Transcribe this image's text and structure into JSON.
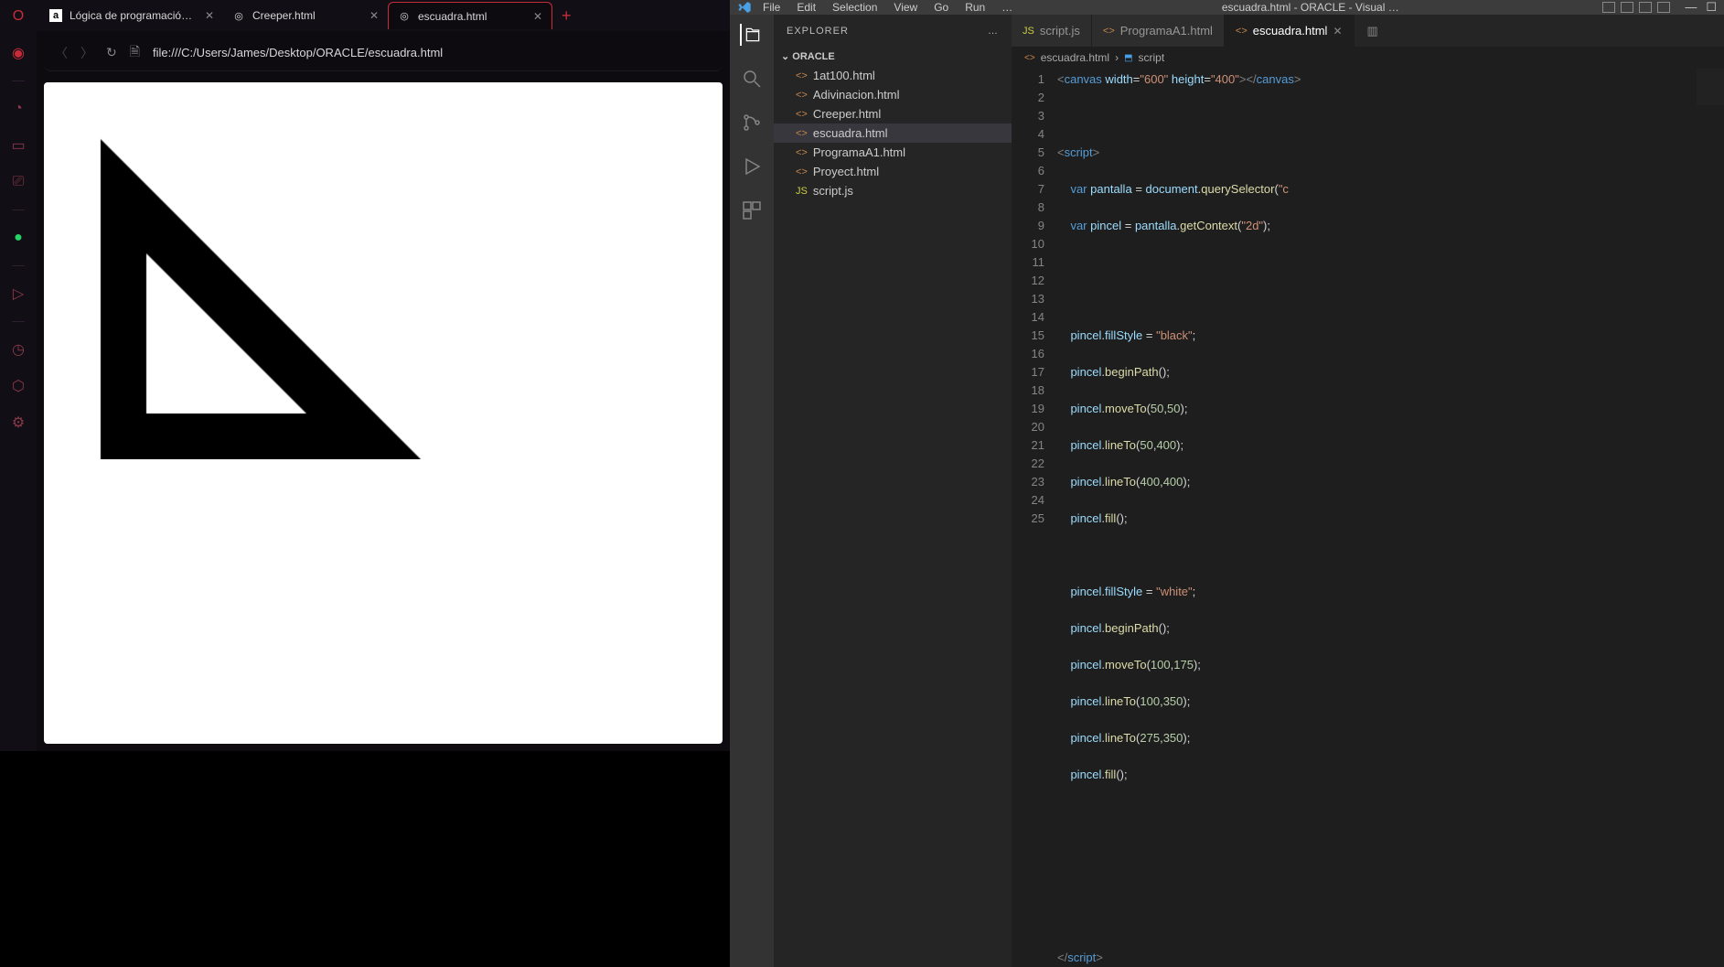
{
  "opera": {
    "tabs": [
      {
        "title": "Lógica de programación: P",
        "favicon": "a"
      },
      {
        "title": "Creeper.html",
        "favicon": "◎"
      },
      {
        "title": "escuadra.html",
        "favicon": "◎",
        "active": true
      }
    ],
    "newtab": "+",
    "url": "file:///C:/Users/James/Desktop/ORACLE/escuadra.html"
  },
  "vscode": {
    "menus": [
      "File",
      "Edit",
      "Selection",
      "View",
      "Go",
      "Run",
      "…"
    ],
    "window_title": "escuadra.html - ORACLE - Visual …",
    "explorer_label": "EXPLORER",
    "folder": "ORACLE",
    "files": [
      {
        "name": "1at100.html",
        "type": "html"
      },
      {
        "name": "Adivinacion.html",
        "type": "html"
      },
      {
        "name": "Creeper.html",
        "type": "html"
      },
      {
        "name": "escuadra.html",
        "type": "html",
        "active": true
      },
      {
        "name": "ProgramaA1.html",
        "type": "html"
      },
      {
        "name": "Proyect.html",
        "type": "html"
      },
      {
        "name": "script.js",
        "type": "js"
      }
    ],
    "editor_tabs": [
      {
        "name": "script.js",
        "type": "js"
      },
      {
        "name": "ProgramaA1.html",
        "type": "html"
      },
      {
        "name": "escuadra.html",
        "type": "html",
        "active": true
      }
    ],
    "breadcrumb": {
      "file": "escuadra.html",
      "symbol": "script"
    },
    "code_lines": 25
  }
}
